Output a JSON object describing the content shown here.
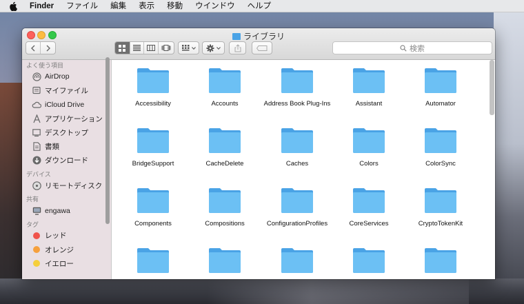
{
  "menubar": {
    "app_name": "Finder",
    "items": [
      "ファイル",
      "編集",
      "表示",
      "移動",
      "ウインドウ",
      "ヘルプ"
    ]
  },
  "window": {
    "title": "ライブラリ",
    "search_placeholder": "検索"
  },
  "sidebar": {
    "sections": [
      {
        "heading": "よく使う項目",
        "items": [
          {
            "label": "AirDrop",
            "icon": "airdrop-icon"
          },
          {
            "label": "マイファイル",
            "icon": "all-files-icon"
          },
          {
            "label": "iCloud Drive",
            "icon": "cloud-icon"
          },
          {
            "label": "アプリケーション",
            "icon": "applications-icon"
          },
          {
            "label": "デスクトップ",
            "icon": "desktop-icon"
          },
          {
            "label": "書類",
            "icon": "document-icon"
          },
          {
            "label": "ダウンロード",
            "icon": "download-icon"
          }
        ]
      },
      {
        "heading": "デバイス",
        "items": [
          {
            "label": "リモートディスク",
            "icon": "disc-icon"
          }
        ]
      },
      {
        "heading": "共有",
        "items": [
          {
            "label": "engawa",
            "icon": "computer-icon"
          }
        ]
      },
      {
        "heading": "タグ",
        "items": [
          {
            "label": "レッド",
            "icon": "tag-dot-icon",
            "color": "#f0534b"
          },
          {
            "label": "オレンジ",
            "icon": "tag-dot-icon",
            "color": "#f6a03d"
          },
          {
            "label": "イエロー",
            "icon": "tag-dot-icon",
            "color": "#f5cf3b"
          }
        ]
      }
    ]
  },
  "content": {
    "folders": [
      "Accessibility",
      "Accounts",
      "Address Book Plug-Ins",
      "Assistant",
      "Automator",
      "BridgeSupport",
      "CacheDelete",
      "Caches",
      "Colors",
      "ColorSync",
      "Components",
      "Compositions",
      "ConfigurationProfiles",
      "CoreServices",
      "CryptoTokenKit",
      "",
      "",
      "",
      "",
      ""
    ]
  },
  "colors": {
    "folder_front": "#6cc0f4",
    "folder_back": "#4aa3e6"
  }
}
